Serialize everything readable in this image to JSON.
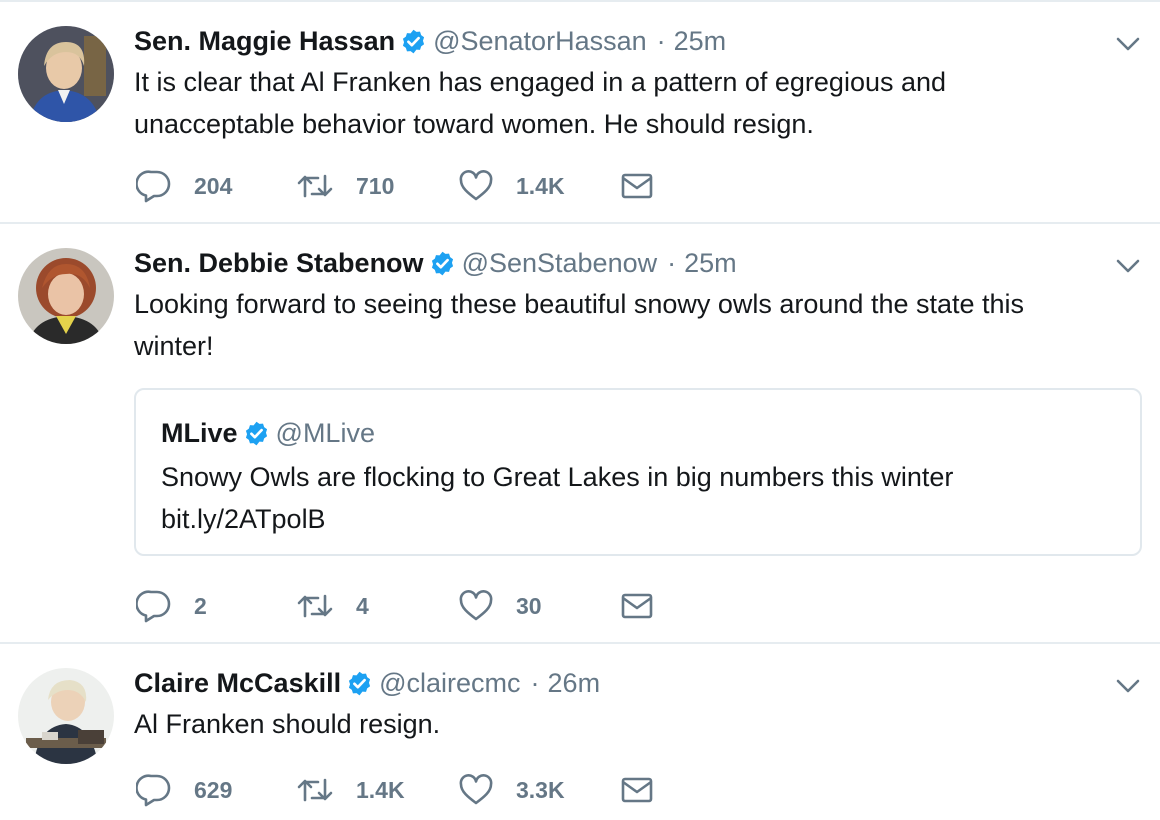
{
  "colors": {
    "text": "#14171a",
    "secondary": "#657786",
    "verified": "#1da1f2",
    "border": "#e6ecf0"
  },
  "tweets": [
    {
      "name": "Sen. Maggie Hassan",
      "handle": "@SenatorHassan",
      "separator": "·",
      "time": "25m",
      "text": "It is clear that Al Franken has engaged in a pattern of egregious and\nunacceptable behavior toward women. He should resign.",
      "avatar_icon": "avatar-photo",
      "actions": {
        "reply_icon": "reply-icon",
        "replies": "204",
        "retweet_icon": "retweet-icon",
        "retweets": "710",
        "like_icon": "heart-icon",
        "likes": "1.4K",
        "dm_icon": "envelope-icon"
      }
    },
    {
      "name": "Sen. Debbie Stabenow",
      "handle": "@SenStabenow",
      "separator": "·",
      "time": "25m",
      "text": "Looking forward to seeing these beautiful snowy owls around the state this\nwinter!",
      "avatar_icon": "avatar-photo",
      "quote": {
        "name": "MLive",
        "handle": "@MLive",
        "text": "Snowy Owls are flocking to Great Lakes in big numbers this winter\nbit.ly/2ATpolB"
      },
      "actions": {
        "reply_icon": "reply-icon",
        "replies": "2",
        "retweet_icon": "retweet-icon",
        "retweets": "4",
        "like_icon": "heart-icon",
        "likes": "30",
        "dm_icon": "envelope-icon"
      }
    },
    {
      "name": "Claire McCaskill",
      "handle": "@clairecmc",
      "separator": "·",
      "time": "26m",
      "text": "Al Franken should resign.",
      "avatar_icon": "avatar-photo",
      "actions": {
        "reply_icon": "reply-icon",
        "replies": "629",
        "retweet_icon": "retweet-icon",
        "retweets": "1.4K",
        "like_icon": "heart-icon",
        "likes": "3.3K",
        "dm_icon": "envelope-icon"
      }
    }
  ]
}
